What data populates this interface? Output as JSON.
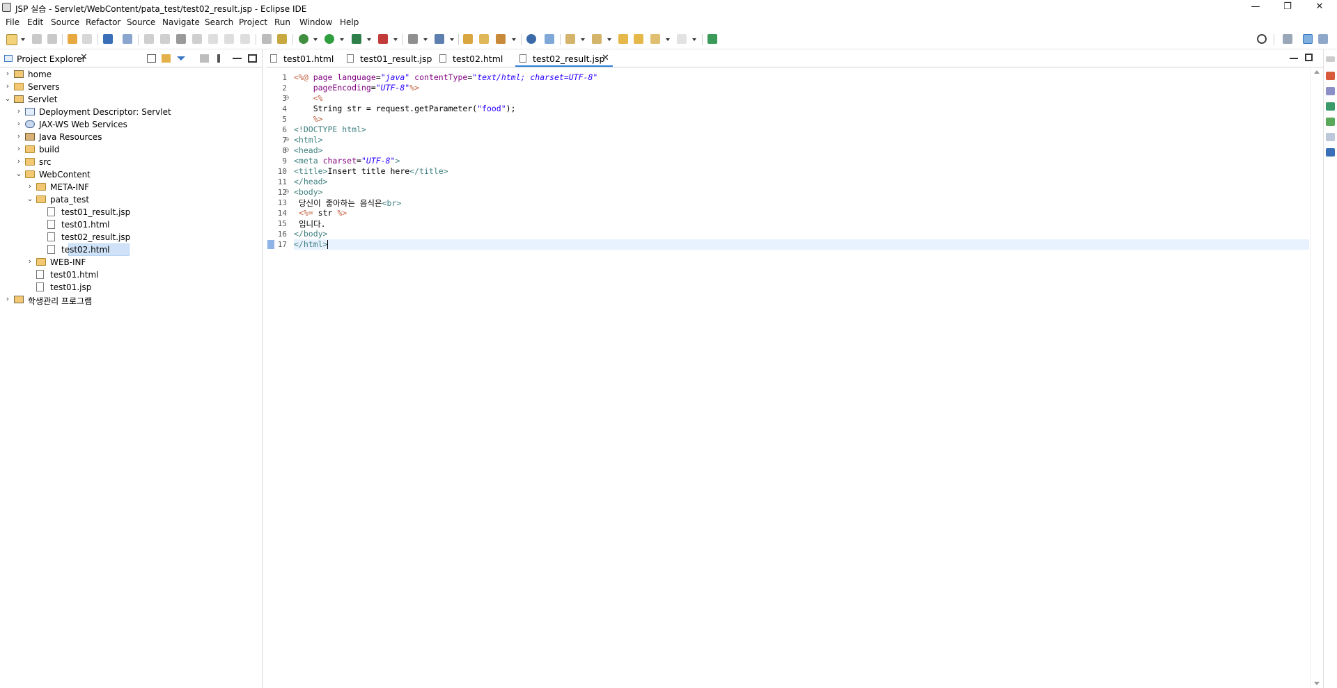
{
  "window": {
    "title": "JSP 실습 - Servlet/WebContent/pata_test/test02_result.jsp - Eclipse IDE",
    "minimize": "—",
    "restore": "❐",
    "close": "✕"
  },
  "menu": [
    "File",
    "Edit",
    "Source",
    "Refactor",
    "Source",
    "Navigate",
    "Search",
    "Project",
    "Run",
    "Window",
    "Help"
  ],
  "project_explorer": {
    "tab_label": "Project Explorer",
    "tree": [
      {
        "label": "home",
        "depth": 0,
        "expanded": false,
        "icon": "project-icon"
      },
      {
        "label": "Servers",
        "depth": 0,
        "expanded": false,
        "icon": "folder-icon"
      },
      {
        "label": "Servlet",
        "depth": 0,
        "expanded": true,
        "icon": "project-icon"
      },
      {
        "label": "Deployment Descriptor: Servlet",
        "depth": 1,
        "expanded": false,
        "icon": "descriptor-icon"
      },
      {
        "label": "JAX-WS Web Services",
        "depth": 1,
        "expanded": false,
        "icon": "webservice-icon"
      },
      {
        "label": "Java Resources",
        "depth": 1,
        "expanded": false,
        "icon": "jar-icon"
      },
      {
        "label": "build",
        "depth": 1,
        "expanded": false,
        "icon": "folder-icon"
      },
      {
        "label": "src",
        "depth": 1,
        "expanded": false,
        "icon": "folder-icon"
      },
      {
        "label": "WebContent",
        "depth": 1,
        "expanded": true,
        "icon": "folder-icon"
      },
      {
        "label": "META-INF",
        "depth": 2,
        "expanded": false,
        "icon": "folder-icon"
      },
      {
        "label": "pata_test",
        "depth": 2,
        "expanded": true,
        "icon": "folder-icon"
      },
      {
        "label": "test01_result.jsp",
        "depth": 3,
        "leaf": true,
        "icon": "file-icon"
      },
      {
        "label": "test01.html",
        "depth": 3,
        "leaf": true,
        "icon": "file-icon"
      },
      {
        "label": "test02_result.jsp",
        "depth": 3,
        "leaf": true,
        "icon": "file-icon"
      },
      {
        "label": "test02.html",
        "depth": 3,
        "leaf": true,
        "icon": "file-icon",
        "selected": true
      },
      {
        "label": "WEB-INF",
        "depth": 2,
        "expanded": false,
        "icon": "folder-icon"
      },
      {
        "label": "test01.html",
        "depth": 2,
        "leaf": true,
        "icon": "file-icon"
      },
      {
        "label": "test01.jsp",
        "depth": 2,
        "leaf": true,
        "icon": "file-icon"
      },
      {
        "label": "학생관리 프로그램",
        "depth": 0,
        "expanded": false,
        "icon": "project-icon"
      }
    ]
  },
  "editor_tabs": [
    {
      "label": "test01.html",
      "active": false
    },
    {
      "label": "test01_result.jsp",
      "active": false
    },
    {
      "label": "test02.html",
      "active": false
    },
    {
      "label": "test02_result.jsp",
      "active": true
    }
  ],
  "code_lines": [
    {
      "n": "1",
      "fold": "",
      "html": "<span class='jd'>&lt;%@</span> <span class='at'>page</span> <span class='at'>language</span>=<span class='av'>\"java\"</span> <span class='at'>contentType</span>=<span class='av'>\"text/html; charset=UTF-8\"</span>"
    },
    {
      "n": "2",
      "fold": "",
      "html": "    <span class='at'>pageEncoding</span>=<span class='av'>\"UTF-8\"</span><span class='jd'>%&gt;</span>"
    },
    {
      "n": "3",
      "fold": "⊖",
      "html": "    <span class='jd'>&lt;%</span>"
    },
    {
      "n": "4",
      "fold": "",
      "html": "    <span class='pl'>String str = request.getParameter(</span><span class='st'>\"food\"</span><span class='pl'>);</span>"
    },
    {
      "n": "5",
      "fold": "",
      "html": "    <span class='jd'>%&gt;</span>"
    },
    {
      "n": "6",
      "fold": "",
      "html": "<span class='tg'>&lt;!DOCTYPE html&gt;</span>"
    },
    {
      "n": "7",
      "fold": "⊖",
      "html": "<span class='tg'>&lt;html&gt;</span>"
    },
    {
      "n": "8",
      "fold": "⊖",
      "html": "<span class='tg'>&lt;head&gt;</span>"
    },
    {
      "n": "9",
      "fold": "",
      "html": "<span class='tg'>&lt;meta</span> <span class='at'>charset</span>=<span class='av'>\"UTF-8\"</span><span class='tg'>&gt;</span>"
    },
    {
      "n": "10",
      "fold": "",
      "html": "<span class='tg'>&lt;title&gt;</span><span class='pl'>Insert title here</span><span class='tg'>&lt;/title&gt;</span>"
    },
    {
      "n": "11",
      "fold": "",
      "html": "<span class='tg'>&lt;/head&gt;</span>"
    },
    {
      "n": "12",
      "fold": "⊖",
      "html": "<span class='tg'>&lt;body&gt;</span>"
    },
    {
      "n": "13",
      "fold": "",
      "html": " <span class='pl'>당신이 좋아하는 음식은</span><span class='tg'>&lt;br&gt;</span>"
    },
    {
      "n": "14",
      "fold": "",
      "html": " <span class='jd'>&lt;%=</span> <span class='pl'>str</span> <span class='jd'>%&gt;</span>"
    },
    {
      "n": "15",
      "fold": "",
      "html": " <span class='pl'>입니다.</span>"
    },
    {
      "n": "16",
      "fold": "",
      "html": "<span class='tg'>&lt;/body&gt;</span>"
    },
    {
      "n": "17",
      "fold": "",
      "html": "<span class='tg'>&lt;/html&gt;</span><span class='caret'></span>",
      "current": true
    }
  ]
}
